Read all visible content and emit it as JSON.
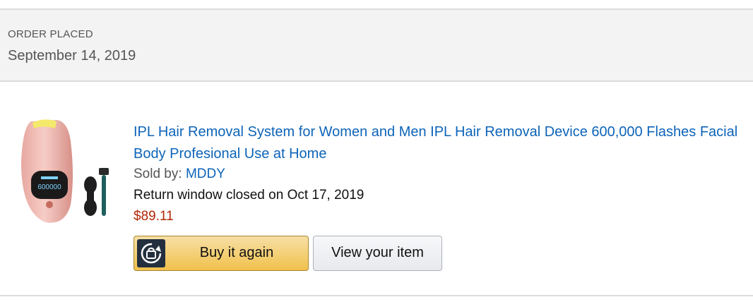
{
  "order": {
    "placed_label": "ORDER PLACED",
    "date": "September 14, 2019"
  },
  "item": {
    "title": "IPL Hair Removal System for Women and Men IPL Hair Removal Device 600,000 Flashes Facial Body Profesional Use at Home",
    "sold_by_label": "Sold by:",
    "seller": "MDDY",
    "return_window": "Return window closed on Oct 17, 2019",
    "price": "$89.11",
    "image_icon": "pink-ipl-device-with-goggles-and-razor",
    "device_display": "600000"
  },
  "actions": {
    "buy_again_label": "Buy it again",
    "buy_again_icon": "repeat-bag-icon",
    "view_item_label": "View your item"
  },
  "colors": {
    "link": "#0d64b8",
    "price": "#b12704",
    "header_bg": "#f3f3f3",
    "buy_button": "#f0c14b",
    "buy_icon_bg": "#232f3e"
  }
}
